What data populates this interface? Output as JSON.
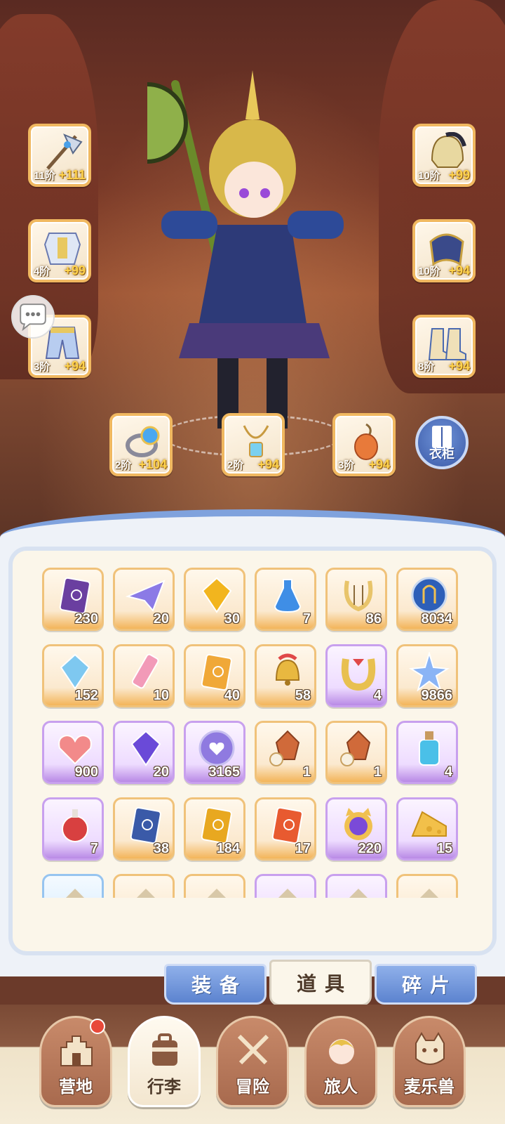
{
  "equipment": {
    "left": [
      {
        "icon": "halberd-icon",
        "tier": "11阶",
        "bonus": "+111"
      },
      {
        "icon": "armor-icon",
        "tier": "4阶",
        "bonus": "+99"
      },
      {
        "icon": "pants-icon",
        "tier": "3阶",
        "bonus": "+94"
      }
    ],
    "right": [
      {
        "icon": "helmet-icon",
        "tier": "10阶",
        "bonus": "+99"
      },
      {
        "icon": "cloak-icon",
        "tier": "10阶",
        "bonus": "+94"
      },
      {
        "icon": "boots-icon",
        "tier": "8阶",
        "bonus": "+94"
      }
    ],
    "bottom": [
      {
        "icon": "ring-icon",
        "tier": "2阶",
        "bonus": "+104"
      },
      {
        "icon": "necklace-icon",
        "tier": "2阶",
        "bonus": "+94"
      },
      {
        "icon": "pendant-icon",
        "tier": "3阶",
        "bonus": "+94"
      }
    ]
  },
  "wardrobe_label": "衣柜",
  "items": [
    {
      "icon": "ticket-icon",
      "count": "230",
      "rarity": "orange",
      "color": "#6a3fa0"
    },
    {
      "icon": "paper-plane-icon",
      "count": "20",
      "rarity": "orange",
      "color": "#8b7ae6"
    },
    {
      "icon": "gold-crystal-icon",
      "count": "30",
      "rarity": "orange",
      "color": "#f2b51e"
    },
    {
      "icon": "blue-potion-icon",
      "count": "7",
      "rarity": "orange",
      "color": "#3f8ee6"
    },
    {
      "icon": "lyre-icon",
      "count": "86",
      "rarity": "orange",
      "color": "#e8c46a"
    },
    {
      "icon": "portal-orb-icon",
      "count": "8034",
      "rarity": "orange",
      "color": "#2d5fb8"
    },
    {
      "icon": "ice-crystal-icon",
      "count": "152",
      "rarity": "orange",
      "color": "#7ec8f0"
    },
    {
      "icon": "rainbow-tube-icon",
      "count": "10",
      "rarity": "orange",
      "color": "#f29ab8"
    },
    {
      "icon": "outfit-card-icon",
      "count": "40",
      "rarity": "orange",
      "color": "#f0a838"
    },
    {
      "icon": "bell-icon",
      "count": "58",
      "rarity": "orange",
      "color": "#e8b840"
    },
    {
      "icon": "horseshoe-icon",
      "count": "4",
      "rarity": "purple",
      "color": "#e04848"
    },
    {
      "icon": "star-crystal-icon",
      "count": "9866",
      "rarity": "orange",
      "color": "#8ab4f5"
    },
    {
      "icon": "heart-icon",
      "count": "900",
      "rarity": "purple",
      "color": "#f28a8a"
    },
    {
      "icon": "purple-gem-icon",
      "count": "20",
      "rarity": "purple",
      "color": "#6a4ad8"
    },
    {
      "icon": "heart-coin-icon",
      "count": "3165",
      "rarity": "purple",
      "color": "#8f7ae0"
    },
    {
      "icon": "ore-sword-icon",
      "count": "1",
      "rarity": "orange",
      "color": "#d06a3a"
    },
    {
      "icon": "ore-boot-icon",
      "count": "1",
      "rarity": "orange",
      "color": "#d06a3a"
    },
    {
      "icon": "cyan-potion-icon",
      "count": "4",
      "rarity": "purple",
      "color": "#4ac0e8"
    },
    {
      "icon": "red-potion-icon",
      "count": "7",
      "rarity": "purple",
      "color": "#d84040"
    },
    {
      "icon": "blue-card-icon",
      "count": "38",
      "rarity": "orange",
      "color": "#3a5aa8"
    },
    {
      "icon": "gold-card-icon",
      "count": "184",
      "rarity": "orange",
      "color": "#e8a820"
    },
    {
      "icon": "red-card-icon",
      "count": "17",
      "rarity": "orange",
      "color": "#e85a30"
    },
    {
      "icon": "cat-mirror-icon",
      "count": "220",
      "rarity": "purple",
      "color": "#7a4ad8"
    },
    {
      "icon": "cheese-icon",
      "count": "15",
      "rarity": "purple",
      "color": "#f2c04a"
    }
  ],
  "partial_row": [
    {
      "icon": "partial-item-icon",
      "rarity": "blue"
    },
    {
      "icon": "partial-item-icon",
      "rarity": "orange"
    },
    {
      "icon": "partial-item-icon",
      "rarity": "orange"
    },
    {
      "icon": "partial-item-icon",
      "rarity": "purple"
    },
    {
      "icon": "partial-item-icon",
      "rarity": "purple"
    },
    {
      "icon": "partial-item-icon",
      "rarity": "orange"
    }
  ],
  "tabs": [
    {
      "label": "装备",
      "active": false
    },
    {
      "label": "道具",
      "active": true
    },
    {
      "label": "碎片",
      "active": false
    }
  ],
  "nav": [
    {
      "label": "营地",
      "icon": "castle-icon",
      "active": false,
      "badge": true
    },
    {
      "label": "行李",
      "icon": "backpack-icon",
      "active": true,
      "badge": false
    },
    {
      "label": "冒险",
      "icon": "crossed-swords-icon",
      "active": false,
      "badge": false
    },
    {
      "label": "旅人",
      "icon": "traveler-face-icon",
      "active": false,
      "badge": false
    },
    {
      "label": "麦乐兽",
      "icon": "cat-face-icon",
      "active": false,
      "badge": false
    }
  ]
}
